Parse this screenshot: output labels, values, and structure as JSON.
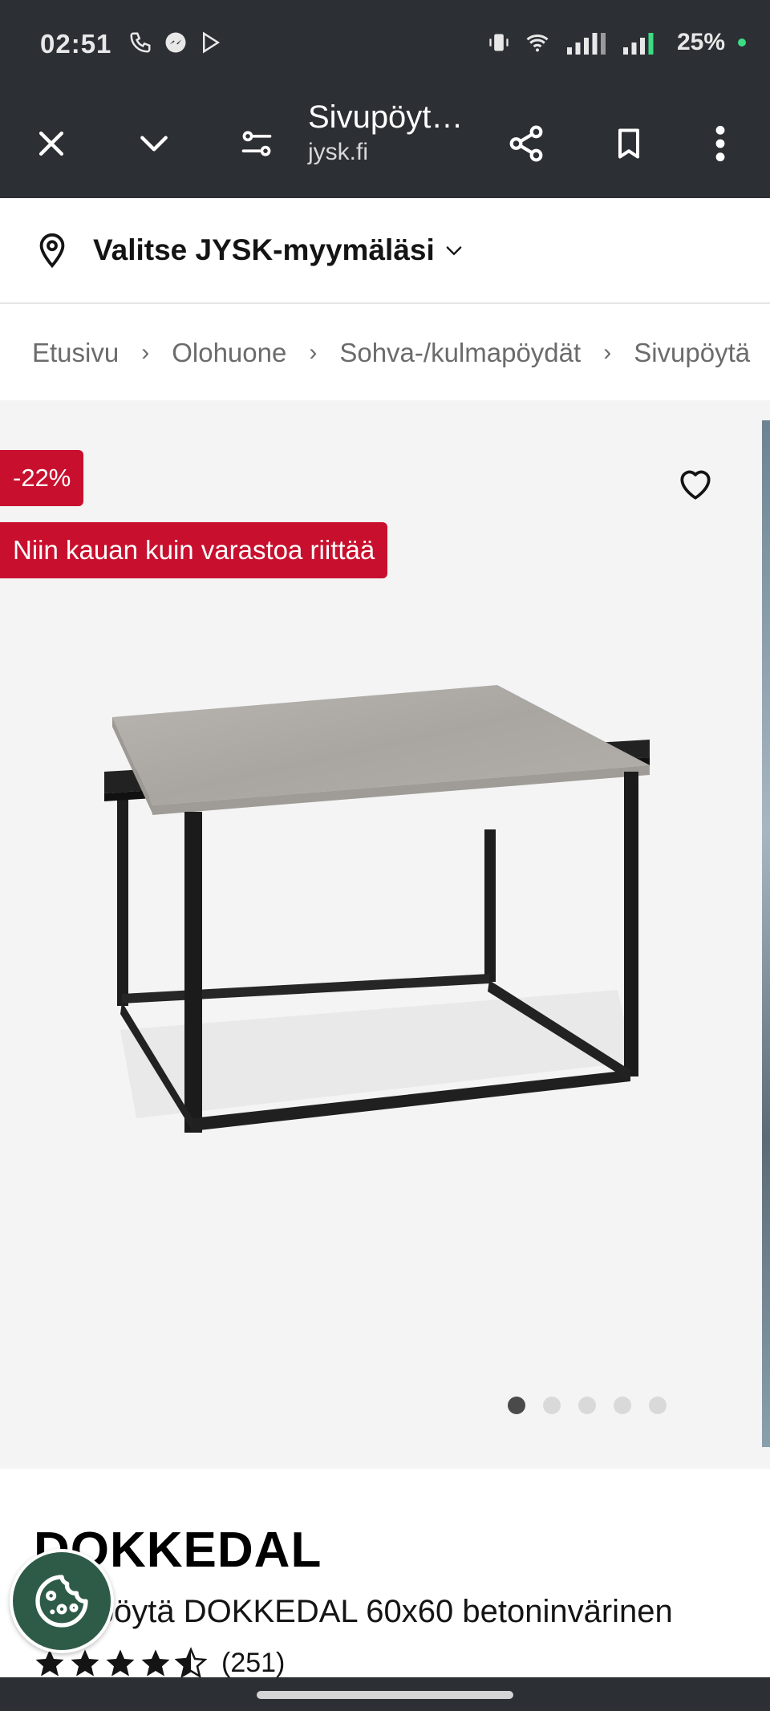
{
  "status_bar": {
    "time": "02:51",
    "battery": "25%"
  },
  "toolbar": {
    "title": "Sivupöyt…",
    "subtitle": "jysk.fi",
    "icons": [
      "close-icon",
      "chevron-down-icon",
      "tune-icon",
      "share-icon",
      "bookmark-icon",
      "more-vert-icon"
    ]
  },
  "store": {
    "label": "Valitse JYSK-myymäläsi"
  },
  "breadcrumb": {
    "items": [
      "Etusivu",
      "Olohuone",
      "Sohva-/kulmapöydät",
      "Sivupöytä"
    ]
  },
  "gallery": {
    "discount": "-22%",
    "stock_badge": "Niin kauan kuin varastoa riittää",
    "dot_count": 5,
    "active_dot": 0
  },
  "product": {
    "brand": "DOKKEDAL",
    "name": "Sivupöytä DOKKEDAL 60x60 betoninvärinen",
    "rating": 4.5,
    "review_count": "(251)"
  },
  "colors": {
    "chrome": "#2c2f33",
    "badge_red": "#c8102e",
    "cookie_green": "#2e5b47"
  }
}
